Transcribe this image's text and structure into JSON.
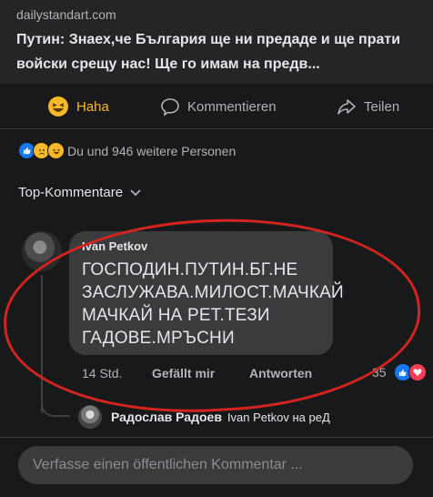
{
  "link_preview": {
    "domain": "dailystandart.com",
    "headline": "Путин: Знаех,че България ще ни предаде и ще прати войски срещу нас! Ще го имам на предв..."
  },
  "actions": {
    "haha": "Haha",
    "comment": "Kommentieren",
    "share": "Teilen"
  },
  "reactions_summary": {
    "text": "Du und 946 weitere Personen",
    "icons": [
      "like-reaction-icon",
      "sad-reaction-icon",
      "haha-reaction-icon"
    ]
  },
  "comment_filter": "Top-Kommentare",
  "comment": {
    "author": "Ivan Petkov",
    "text": "ГОСПОДИН.ПУТИН.БГ.НЕ ЗАСЛУЖАВА.МИЛОСТ.МАЧКАЙ МАЧКАЙ НА РЕТ.ТЕЗИ ГАДОВЕ.МРЪСНИ",
    "time": "14 Std.",
    "like_label": "Gefällt mir",
    "reply_label": "Antworten",
    "reaction_count": "35"
  },
  "reply_preview": {
    "author": "Радослав Радоев",
    "snippet": "Ivan Petkov на реД"
  },
  "composer": {
    "placeholder": "Verfasse einen öffentlichen Kommentar ..."
  },
  "colors": {
    "background": "#18191a",
    "bubble": "#3a3b3c",
    "haha_accent": "#f7b928",
    "like_blue": "#1877f2",
    "love_red": "#f33e58",
    "annotation_red": "#d42420"
  }
}
